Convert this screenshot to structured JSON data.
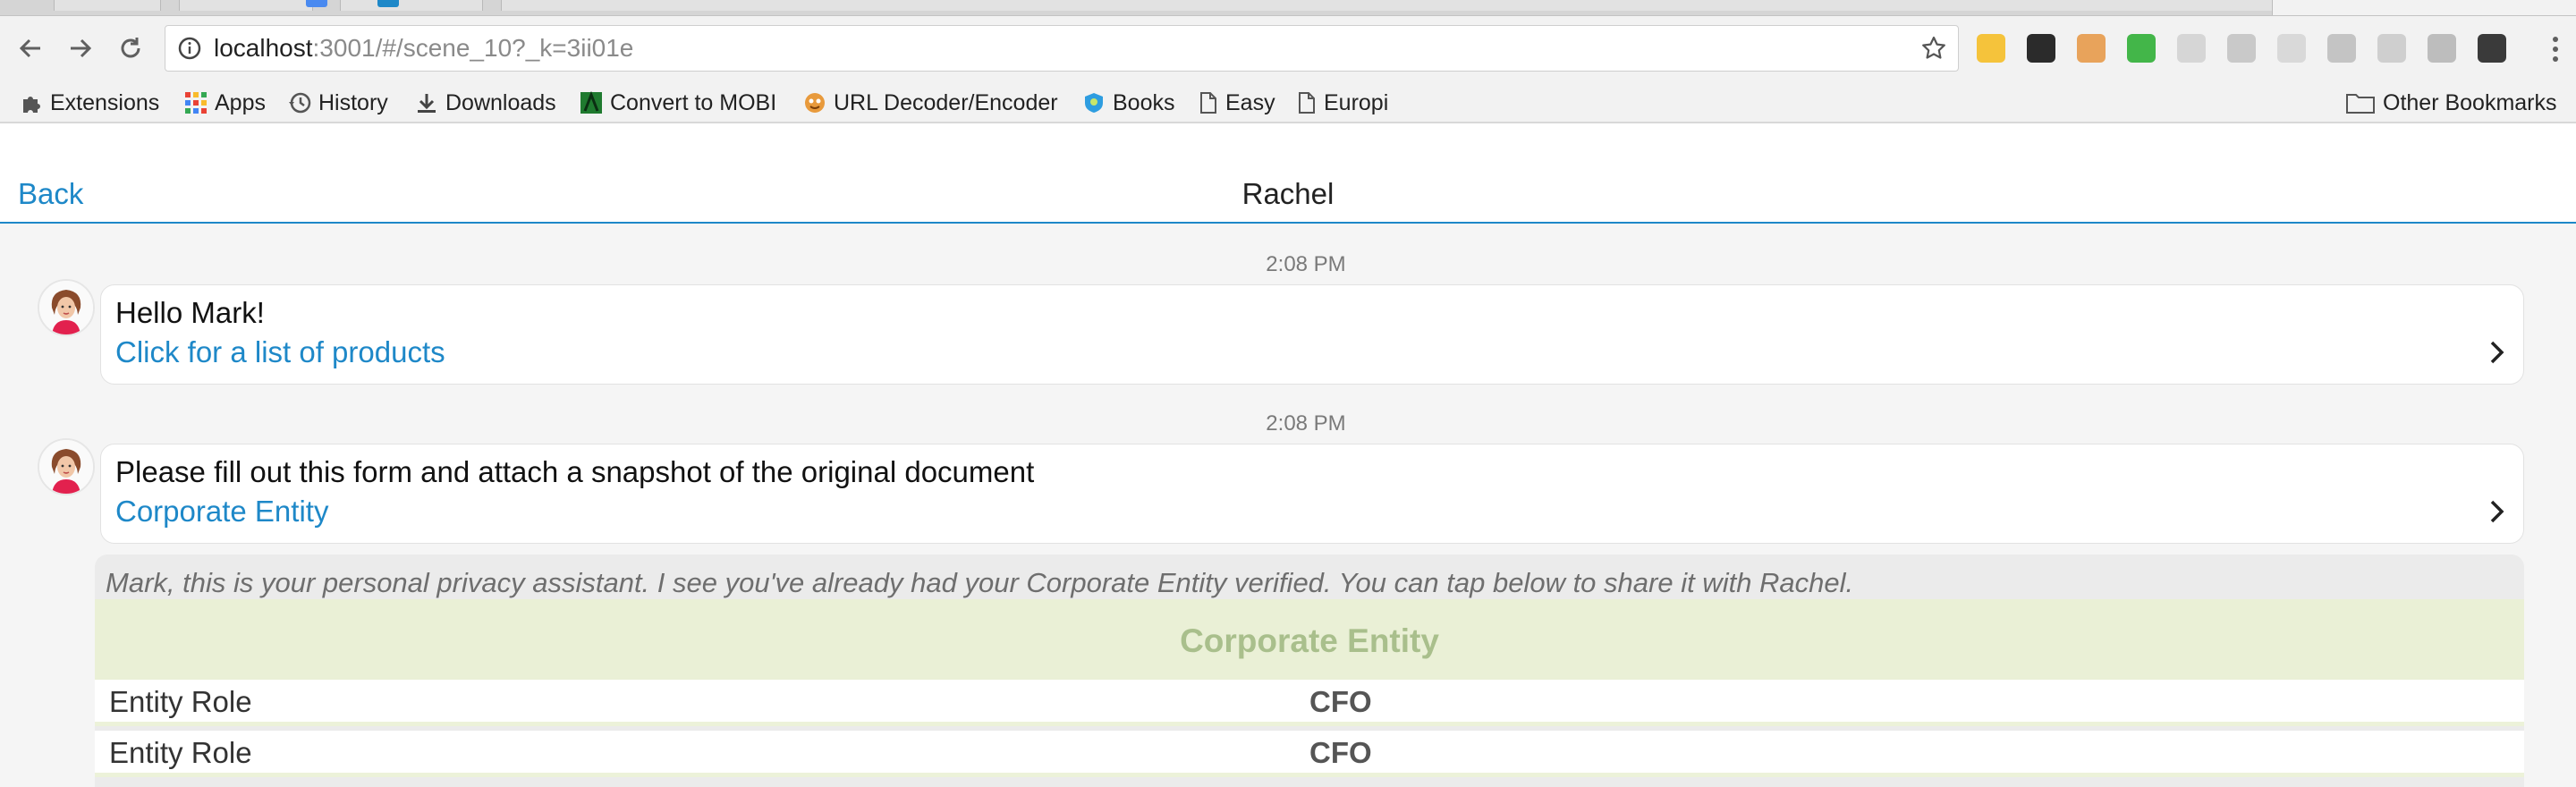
{
  "browser": {
    "url": {
      "host": "localhost",
      "rest": ":3001/#/scene_10?_k=3ii01e"
    },
    "bookmarks": [
      {
        "label": "Extensions",
        "icon": "puzzle-icon"
      },
      {
        "label": "Apps",
        "icon": "apps-grid-icon"
      },
      {
        "label": "History",
        "icon": "history-icon"
      },
      {
        "label": "Downloads",
        "icon": "download-icon"
      },
      {
        "label": "Convert to MOBI",
        "icon": "mobi-icon"
      },
      {
        "label": "URL Decoder/Encoder",
        "icon": "decoder-icon"
      },
      {
        "label": "Books",
        "icon": "books-icon"
      },
      {
        "label": "Easy",
        "icon": "page-icon"
      },
      {
        "label": "Europi",
        "icon": "page-icon"
      }
    ],
    "other_bookmarks": "Other Bookmarks",
    "extension_colors": [
      "#f5c33b",
      "#2b2b2b",
      "#e8a35b",
      "#43b649",
      "#d6d6d6",
      "#c9c9c9",
      "#d9d9d9",
      "#c4c4c4",
      "#cfcfcf",
      "#bdbdbd",
      "#3a3a3a"
    ]
  },
  "header": {
    "back_label": "Back",
    "title": "Rachel"
  },
  "messages": [
    {
      "time": "2:08 PM",
      "text": "Hello Mark!",
      "link": "Click for a list of products"
    },
    {
      "time": "2:08 PM",
      "text": "Please fill out this form and attach a snapshot of the original document",
      "link": "Corporate Entity"
    }
  ],
  "assistant": {
    "note": "Mark, this is your personal privacy assistant. I see you've already had your Corporate Entity verified. You can tap below to share it with Rachel.",
    "card_title": "Corporate Entity",
    "rows": [
      {
        "key": "Entity Role",
        "value": "CFO"
      },
      {
        "key": "Entity Role",
        "value": "CFO"
      }
    ]
  },
  "colors": {
    "accent": "#1e88c8",
    "card_header_bg": "#eaf0d6",
    "card_header_text": "#a9bf8c"
  }
}
